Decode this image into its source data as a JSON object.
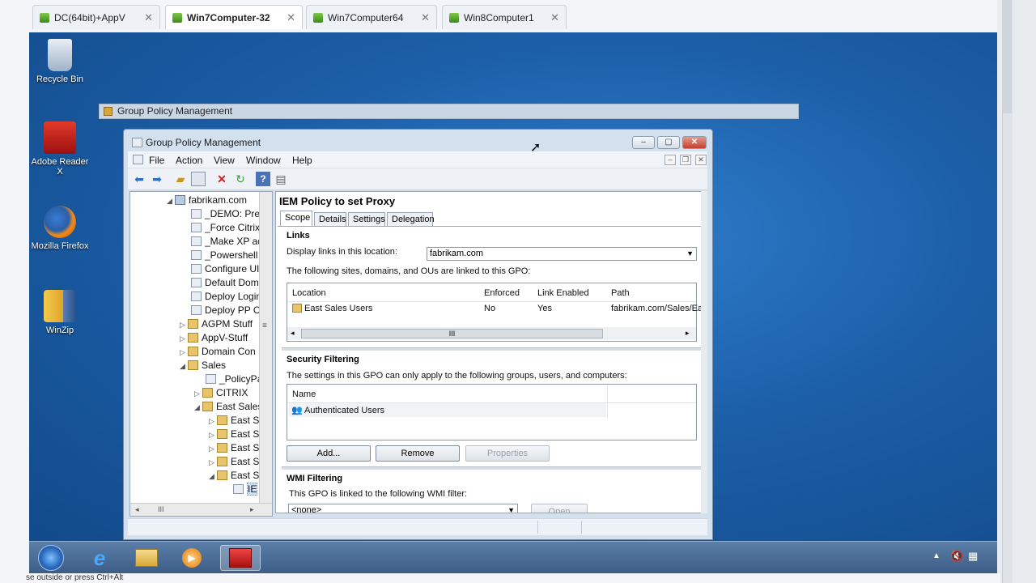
{
  "host_tabs": [
    {
      "label": "DC(64bit)+AppV",
      "active": false
    },
    {
      "label": "Win7Computer-32",
      "active": true
    },
    {
      "label": "Win7Computer64",
      "active": false
    },
    {
      "label": "Win8Computer1",
      "active": false
    }
  ],
  "tab_close_glyph": "✕",
  "desktop_icons": [
    {
      "label": "Recycle Bin",
      "icon": "recycle-bin-icon"
    },
    {
      "label": "Adobe Reader X",
      "icon": "adobe-reader-icon"
    },
    {
      "label": "Mozilla Firefox",
      "icon": "firefox-icon"
    },
    {
      "label": "WinZip",
      "icon": "winzip-icon"
    }
  ],
  "ghost_title": "Group Policy Management",
  "window": {
    "title": "Group Policy Management",
    "caption": {
      "minimize": "‒",
      "maximize": "▢",
      "close": "✕"
    },
    "menus": [
      "File",
      "Action",
      "View",
      "Window",
      "Help"
    ],
    "mdi_buttons": [
      "‒",
      "❐",
      "✕"
    ]
  },
  "toolbar_icons": [
    "back-icon",
    "forward-icon",
    "up-folder-icon",
    "show-hide-tree-icon",
    "delete-icon",
    "refresh-icon",
    "help-icon",
    "properties-icon"
  ],
  "tree": [
    {
      "label": "fabrikam.com",
      "exp": "◢",
      "type": "dom"
    },
    {
      "label": "_DEMO: Prev",
      "exp": "",
      "type": "gpo"
    },
    {
      "label": "_Force Citrix",
      "exp": "",
      "type": "gpo"
    },
    {
      "label": "_Make XP ac",
      "exp": "",
      "type": "gpo"
    },
    {
      "label": "_Powershell",
      "exp": "",
      "type": "gpo"
    },
    {
      "label": "Configure UI",
      "exp": "",
      "type": "gpo"
    },
    {
      "label": "Default Dom",
      "exp": "",
      "type": "gpo"
    },
    {
      "label": "Deploy Login",
      "exp": "",
      "type": "gpo"
    },
    {
      "label": "Deploy PP C",
      "exp": "",
      "type": "gpo"
    },
    {
      "label": "AGPM Stuff",
      "exp": "▷",
      "type": "ou"
    },
    {
      "label": "AppV-Stuff",
      "exp": "▷",
      "type": "ou"
    },
    {
      "label": "Domain Con",
      "exp": "▷",
      "type": "ou"
    },
    {
      "label": "Sales",
      "exp": "◢",
      "type": "ou"
    },
    {
      "label": "_PolicyPa",
      "exp": "",
      "type": "gpo"
    },
    {
      "label": "CITRIX",
      "exp": "▷",
      "type": "ou"
    },
    {
      "label": "East Sales",
      "exp": "◢",
      "type": "ou"
    },
    {
      "label": "East S",
      "exp": "▷",
      "type": "ou"
    },
    {
      "label": "East S",
      "exp": "▷",
      "type": "ou"
    },
    {
      "label": "East S",
      "exp": "▷",
      "type": "ou"
    },
    {
      "label": "East S",
      "exp": "▷",
      "type": "ou"
    },
    {
      "label": "East S",
      "exp": "◢",
      "type": "ou"
    },
    {
      "label": "IE",
      "exp": "",
      "type": "gpo"
    }
  ],
  "tree_hscroll_grip": "III",
  "tree_vscroll_grip": "≡",
  "policy": {
    "title": "IEM Policy to set Proxy",
    "tabs": [
      "Scope",
      "Details",
      "Settings",
      "Delegation"
    ],
    "links": {
      "heading": "Links",
      "display_label": "Display links in this location:",
      "display_value": "fabrikam.com",
      "desc": "The following sites, domains, and OUs are linked to this GPO:",
      "columns": [
        "Location",
        "Enforced",
        "Link Enabled",
        "Path"
      ],
      "rows": [
        {
          "location": "East Sales Users",
          "enforced": "No",
          "link_enabled": "Yes",
          "path": "fabrikam.com/Sales/Ea"
        }
      ],
      "hscroll_grip": "III"
    },
    "security": {
      "heading": "Security Filtering",
      "desc": "The settings in this GPO can only apply to the following groups, users, and computers:",
      "column": "Name",
      "rows": [
        "Authenticated Users"
      ],
      "buttons": {
        "add": "Add...",
        "remove": "Remove",
        "properties": "Properties"
      }
    },
    "wmi": {
      "heading": "WMI Filtering",
      "desc": "This GPO is linked to the following WMI filter:",
      "value": "<none>",
      "open": "Open"
    }
  },
  "bottom_text": "se outside or press Ctrl+Alt"
}
